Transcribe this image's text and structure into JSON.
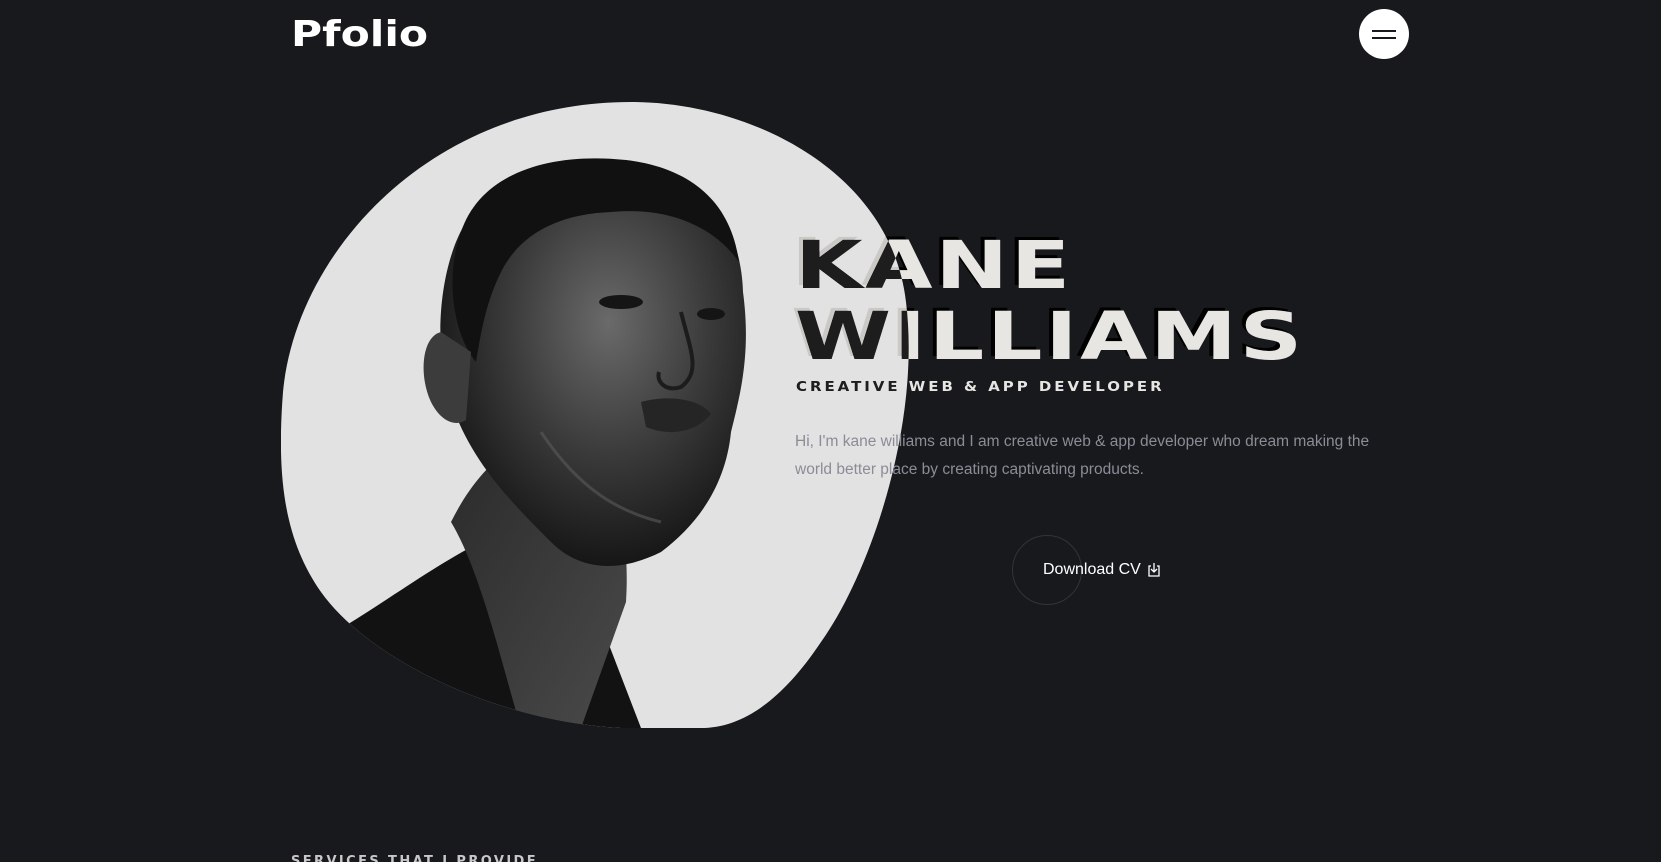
{
  "header": {
    "logo": "Pfolio",
    "menu_icon": "hamburger-menu-icon"
  },
  "hero": {
    "first_name": "KANE",
    "last_name": "WILLIAMS",
    "subtitle": "CREATIVE WEB & APP DEVELOPER",
    "intro": "Hi, I'm kane williams and I am creative web & app developer who dream making the world better place by creating captivating products.",
    "cv_button_label": "Download CV",
    "cv_icon": "download-icon",
    "portrait_alt": "portrait-photo"
  },
  "sections": {
    "services_label": "SERVICES THAT I PROVIDE"
  },
  "colors": {
    "background": "#18191d",
    "text": "#ffffff",
    "muted_text": "#8b8c96",
    "blob": "#e2e2e2"
  }
}
